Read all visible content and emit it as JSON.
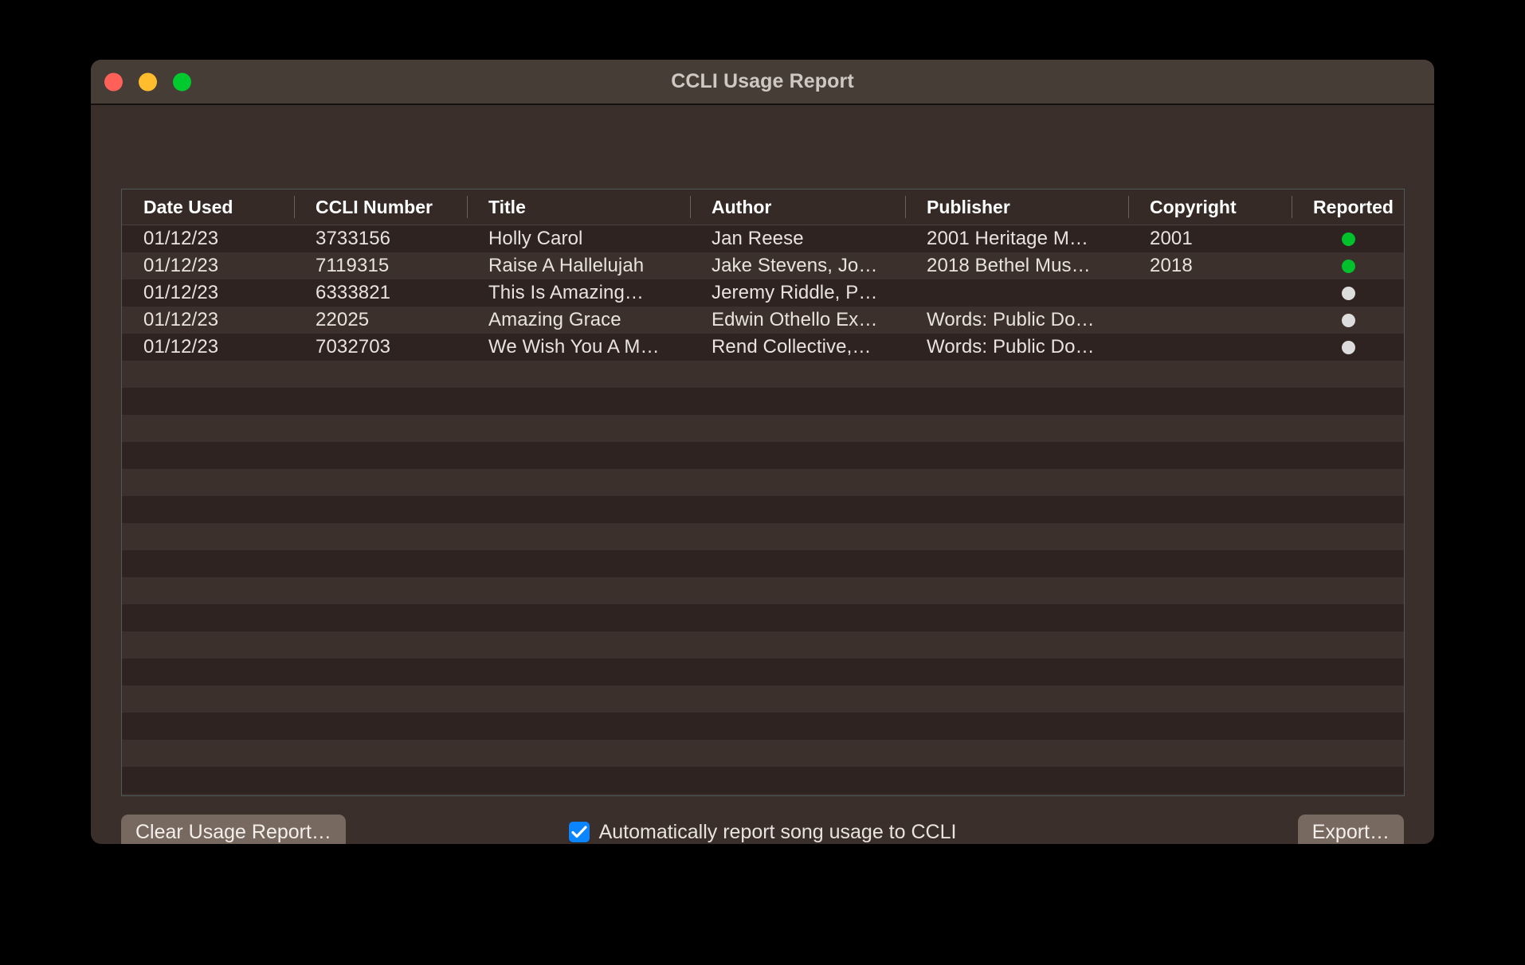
{
  "window": {
    "title": "CCLI Usage Report",
    "traffic_lights": [
      {
        "name": "close-button",
        "color": "#ff6159"
      },
      {
        "name": "minimize-button",
        "color": "#ffbd2e"
      },
      {
        "name": "maximize-button",
        "color": "#00ca2e"
      }
    ]
  },
  "table": {
    "columns": [
      {
        "key": "date",
        "label": "Date Used"
      },
      {
        "key": "ccli",
        "label": "CCLI Number"
      },
      {
        "key": "title",
        "label": "Title"
      },
      {
        "key": "author",
        "label": "Author"
      },
      {
        "key": "publisher",
        "label": "Publisher"
      },
      {
        "key": "copyright",
        "label": "Copyright"
      },
      {
        "key": "reported",
        "label": "Reported"
      }
    ],
    "rows": [
      {
        "date": "01/12/23",
        "ccli": "3733156",
        "title": "Holly Carol",
        "author": "Jan Reese",
        "publisher": "2001 Heritage M…",
        "copyright": "2001",
        "reported": true,
        "reported_icon": "status-dot-reported"
      },
      {
        "date": "01/12/23",
        "ccli": "7119315",
        "title": "Raise A Hallelujah",
        "author": "Jake Stevens, Jo…",
        "publisher": "2018 Bethel Mus…",
        "copyright": "2018",
        "reported": true,
        "reported_icon": "status-dot-reported"
      },
      {
        "date": "01/12/23",
        "ccli": "6333821",
        "title": "This Is Amazing…",
        "author": "Jeremy Riddle, P…",
        "publisher": "",
        "copyright": "",
        "reported": false,
        "reported_icon": "status-dot-unreported"
      },
      {
        "date": "01/12/23",
        "ccli": "22025",
        "title": "Amazing Grace",
        "author": "Edwin Othello Ex…",
        "publisher": "Words: Public Do…",
        "copyright": "",
        "reported": false,
        "reported_icon": "status-dot-unreported"
      },
      {
        "date": "01/12/23",
        "ccli": "7032703",
        "title": "We Wish You A M…",
        "author": "Rend Collective,…",
        "publisher": "Words: Public Do…",
        "copyright": "",
        "reported": false,
        "reported_icon": "status-dot-unreported"
      }
    ],
    "empty_row_count": 21,
    "colors": {
      "reported_dot": "#00c02b",
      "unreported_dot": "#dcdcdc",
      "row_odd": "#2e2320",
      "row_even": "#3b302c",
      "header_bg": "#362a26",
      "border": "#4e5a58"
    }
  },
  "bottom_bar": {
    "clear_button_label": "Clear Usage Report…",
    "export_button_label": "Export…",
    "auto_report_checkbox": {
      "label": "Automatically report song usage to CCLI",
      "checked": true,
      "accent": "#0a84ff"
    }
  }
}
